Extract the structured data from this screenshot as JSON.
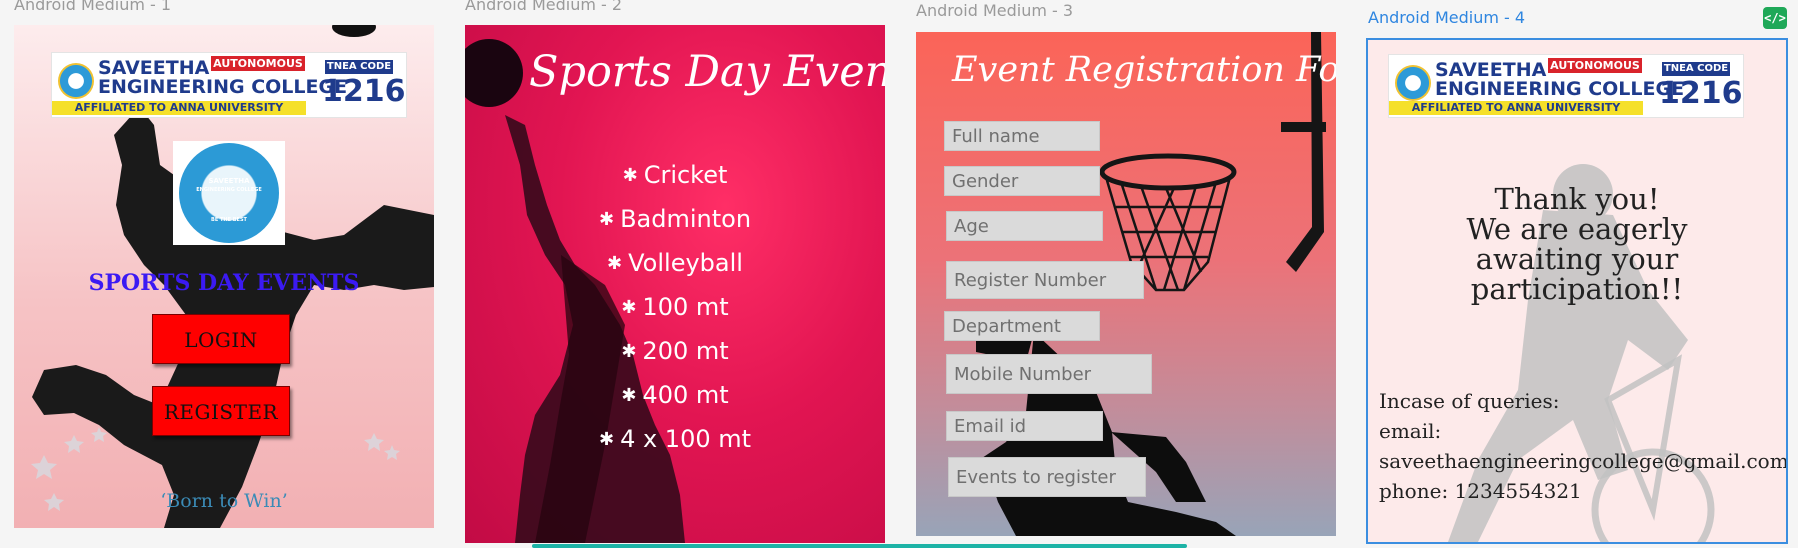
{
  "frames": [
    {
      "label": "Android Medium - 1",
      "college": {
        "name_line1": "SAVEETHA",
        "name_line2": "ENGINEERING COLLEGE",
        "autonomous": "AUTONOMOUS",
        "affiliation": "AFFILIATED TO ANNA UNIVERSITY",
        "tnea_label": "TNEA CODE",
        "tnea_code": "1216"
      },
      "emblem": {
        "line1": "SAVEETHA",
        "line2": "ENGINEERING COLLEGE",
        "line3": "BE THE BEST"
      },
      "title": "SPORTS DAY EVENTS",
      "login_label": "LOGIN",
      "register_label": "REGISTER",
      "slogan": "‘Born to Win’"
    },
    {
      "label": "Android Medium - 2",
      "title": "Sports Day Events..",
      "events": [
        "Cricket",
        "Badminton",
        "Volleyball",
        "100 mt",
        "200 mt",
        "400 mt",
        "4 x 100 mt"
      ]
    },
    {
      "label": "Android Medium - 3",
      "title": "Event Registration Form",
      "fields": [
        "Full name",
        "Gender",
        "Age",
        "Register Number",
        "Department",
        "Mobile Number",
        "Email id",
        "Events to register"
      ]
    },
    {
      "label": "Android Medium - 4",
      "college": {
        "name_line1": "SAVEETHA",
        "name_line2": "ENGINEERING COLLEGE",
        "autonomous": "AUTONOMOUS",
        "affiliation": "AFFILIATED TO ANNA UNIVERSITY",
        "tnea_label": "TNEA CODE",
        "tnea_code": "1216"
      },
      "thanks_lines": [
        "Thank you!",
        "We are eagerly",
        "awaiting your",
        "participation!!"
      ],
      "contact_lines": [
        "Incase of queries:",
        "email:",
        "saveethaengineeringcollege@gmail.com",
        "phone: 1234554321"
      ]
    }
  ],
  "badge": {
    "glyph": "</>"
  },
  "colors": {
    "selection": "#2f86e0",
    "button_red": "#ff0000",
    "title_blue": "#3b1af3",
    "brand_navy": "#1f3b8c",
    "code_badge": "#1fa858"
  },
  "icons": [
    "code-icon",
    "star-icon"
  ]
}
